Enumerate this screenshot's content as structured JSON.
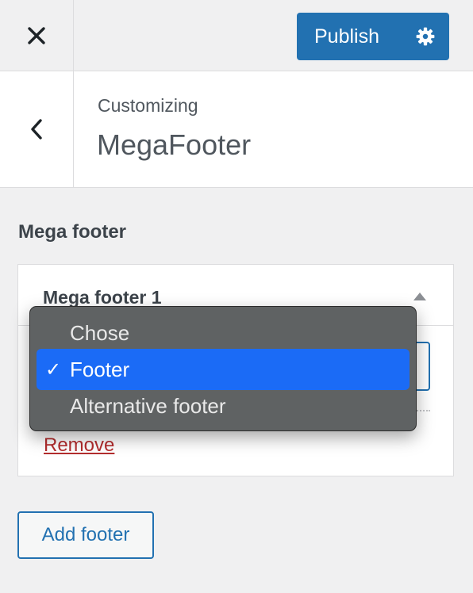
{
  "topbar": {
    "close_icon": "close-icon",
    "publish_label": "Publish",
    "settings_icon": "gear-icon"
  },
  "section": {
    "back_icon": "chevron-left-icon",
    "crumb": "Customizing",
    "title": "MegaFooter"
  },
  "panel": {
    "heading": "Mega footer",
    "widget": {
      "title": "Mega footer 1",
      "toggle_icon": "triangle-up-icon",
      "remove_label": "Remove"
    },
    "add_label": "Add footer"
  },
  "dropdown": {
    "options": [
      {
        "label": "Chose",
        "selected": false
      },
      {
        "label": "Footer",
        "selected": true
      },
      {
        "label": "Alternative footer",
        "selected": false
      }
    ],
    "check_mark": "✓"
  },
  "colors": {
    "accent": "#2271b1",
    "danger": "#b32d2e",
    "menu_bg": "#5f6263",
    "menu_highlight": "#1b6bf6"
  }
}
